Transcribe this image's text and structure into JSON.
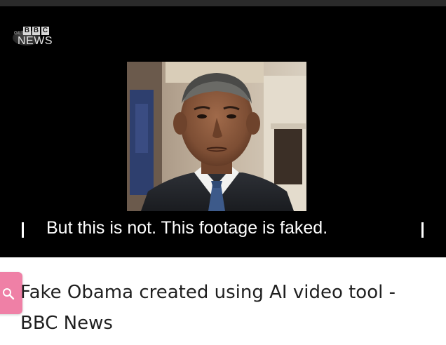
{
  "video": {
    "channel_logo": "BBC",
    "channel_name": "NEWS",
    "logo_badge_text": "GLIT",
    "subtitle": "But this is not. This footage is faked.",
    "footage_icon": "obama-portrait-image"
  },
  "result": {
    "title": "Fake Obama created using AI video tool - BBC News",
    "search_icon": "search-icon"
  },
  "colors": {
    "video_background": "#000000",
    "top_strip": "#2a2a2a",
    "search_button": "#ef80a6",
    "title_text": "#1f1f1f"
  }
}
